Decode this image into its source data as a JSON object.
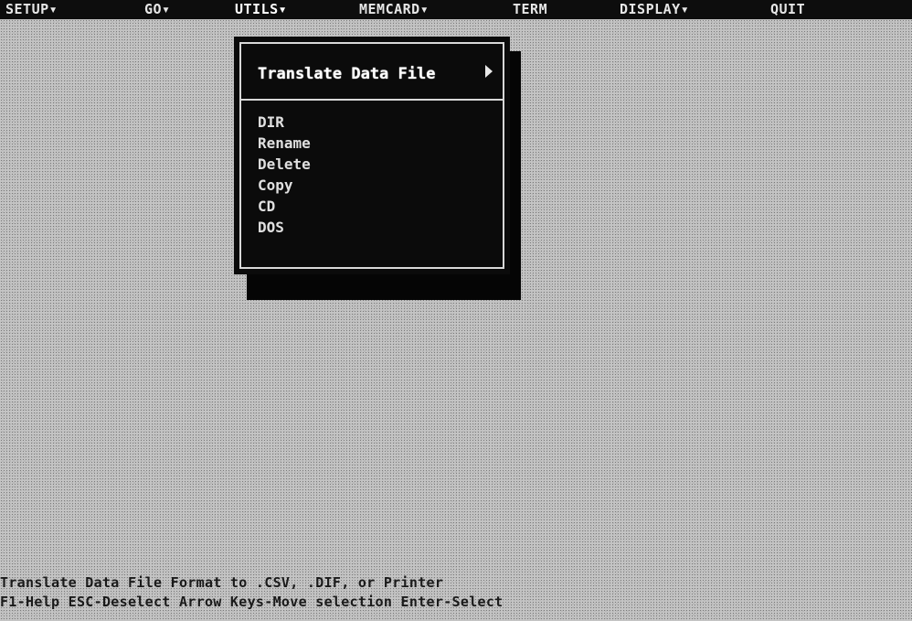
{
  "menubar": {
    "items": [
      {
        "label": "SETUP▾"
      },
      {
        "label": "GO▾"
      },
      {
        "label": "UTILS▾"
      },
      {
        "label": "MEMCARD▾"
      },
      {
        "label": "TERM"
      },
      {
        "label": "DISPLAY▾"
      },
      {
        "label": "QUIT"
      }
    ]
  },
  "dropdown": {
    "highlighted": "Translate Data File",
    "items": [
      "DIR",
      "Rename",
      "Delete",
      "Copy",
      "CD",
      "DOS"
    ]
  },
  "status": {
    "line1": "Translate Data File Format to .CSV, .DIF, or Printer",
    "line2": " F1-Help  ESC-Deselect  Arrow Keys-Move selection  Enter-Select"
  }
}
